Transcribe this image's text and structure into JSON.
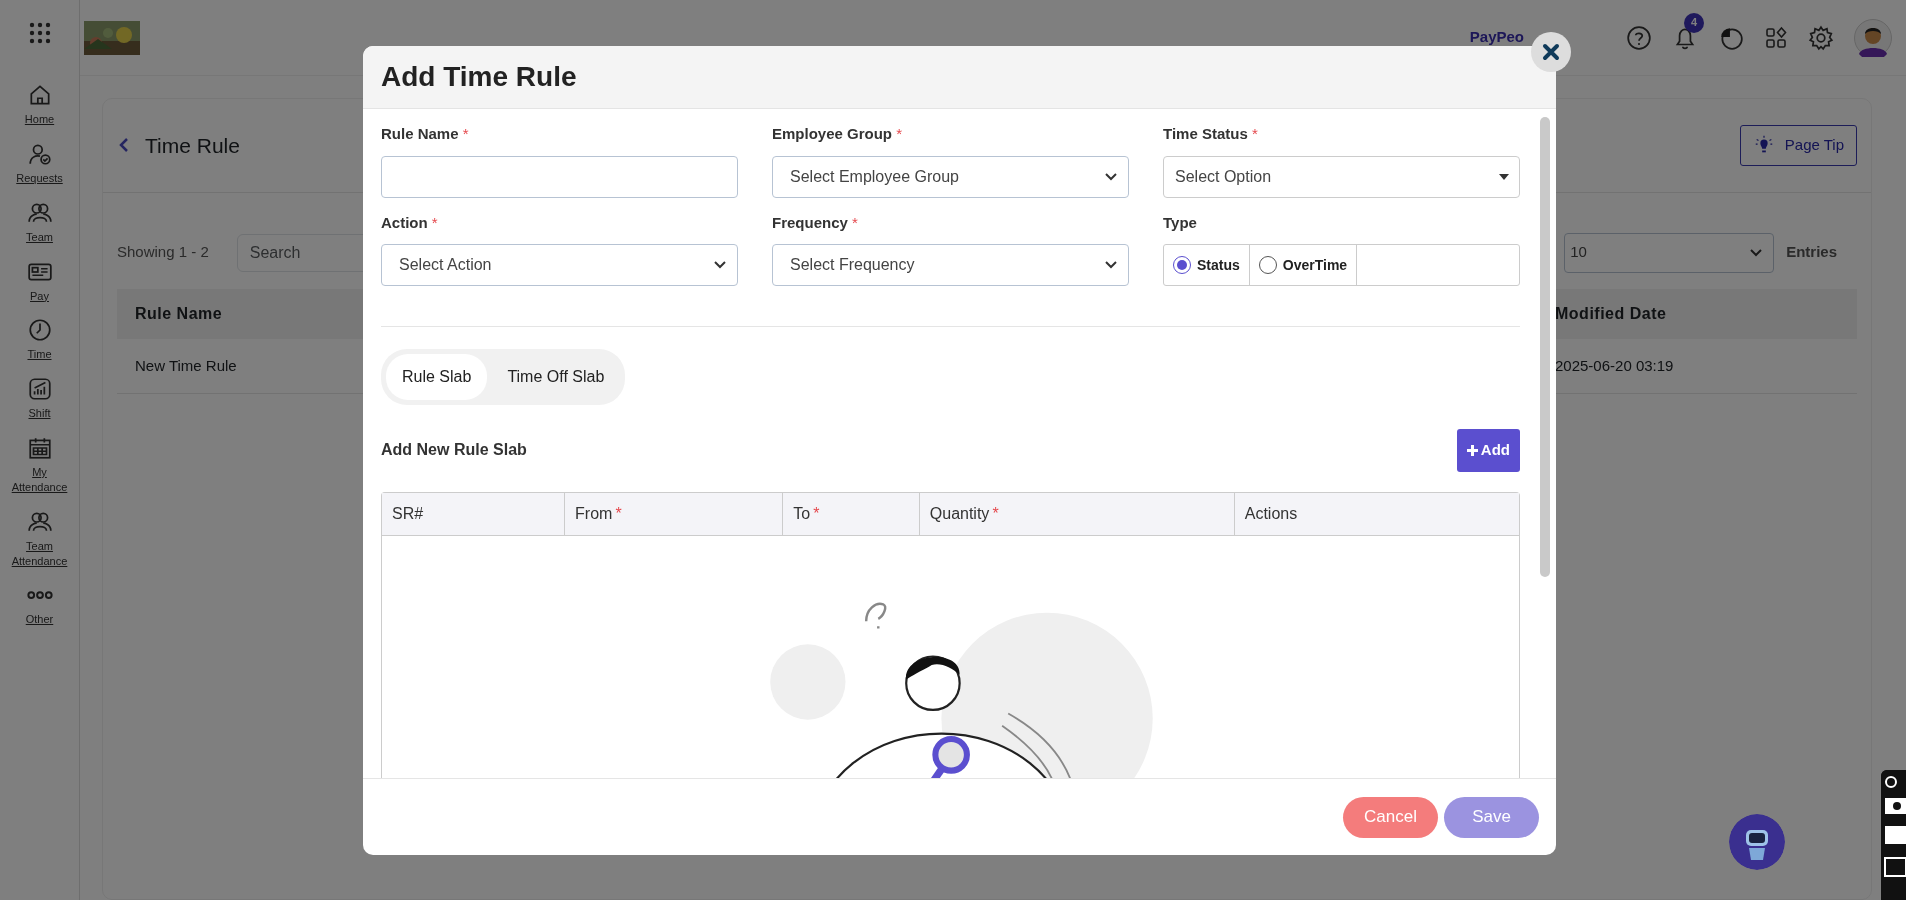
{
  "top_bar": {
    "brand": "PayPeo",
    "notification_count": "4"
  },
  "sidebar": {
    "items": [
      {
        "label": "Home",
        "kind": "home"
      },
      {
        "label": "Requests",
        "kind": "requests"
      },
      {
        "label": "Team",
        "kind": "team"
      },
      {
        "label": "Pay",
        "kind": "pay"
      },
      {
        "label": "Time",
        "kind": "time"
      },
      {
        "label": "Shift",
        "kind": "shift"
      },
      {
        "label": "My Attendance",
        "kind": "calendar"
      },
      {
        "label": "Team Attendance",
        "kind": "team"
      },
      {
        "label": "Other",
        "kind": "other"
      }
    ]
  },
  "page": {
    "title": "Time Rule",
    "page_tip": "Page Tip",
    "showing": "Showing 1 - 2",
    "search_placeholder": "Search",
    "page_size": "10",
    "entries_label": "Entries",
    "table": {
      "columns": [
        "Rule Name",
        "Modified Date"
      ],
      "rows": [
        [
          "New Time Rule",
          "2025-06-20 03:19"
        ]
      ]
    }
  },
  "modal": {
    "title": "Add Time Rule",
    "fields": [
      {
        "label": "Rule Name",
        "required_mark": "*",
        "kind": "text"
      },
      {
        "label": "Employee Group",
        "required_mark": "*",
        "kind": "select",
        "placeholder": "Select Employee Group"
      },
      {
        "label": "Time Status",
        "required_mark": "*",
        "kind": "dropdown",
        "placeholder": "Select Option"
      },
      {
        "label": "Action",
        "required_mark": "*",
        "kind": "select",
        "placeholder": "Select Action"
      },
      {
        "label": "Frequency",
        "required_mark": "*",
        "kind": "select",
        "placeholder": "Select Frequency"
      },
      {
        "label": "Type",
        "kind": "radio",
        "options": [
          {
            "label": "Status",
            "selected": true
          },
          {
            "label": "OverTime",
            "selected": false
          }
        ]
      }
    ],
    "tabs": [
      {
        "label": "Rule Slab",
        "selected": true
      },
      {
        "label": "Time Off Slab",
        "selected": false
      }
    ],
    "section_title": "Add New Rule Slab",
    "add_button": "Add",
    "slab_table": {
      "columns": [
        {
          "label": "SR#"
        },
        {
          "label": "From",
          "required_mark": "*"
        },
        {
          "label": "To",
          "required_mark": "*"
        },
        {
          "label": "Quantity",
          "required_mark": "*"
        },
        {
          "label": "Actions"
        }
      ]
    },
    "buttons": [
      {
        "label": "Cancel",
        "kind": "cancel"
      },
      {
        "label": "Save",
        "kind": "save"
      }
    ]
  }
}
